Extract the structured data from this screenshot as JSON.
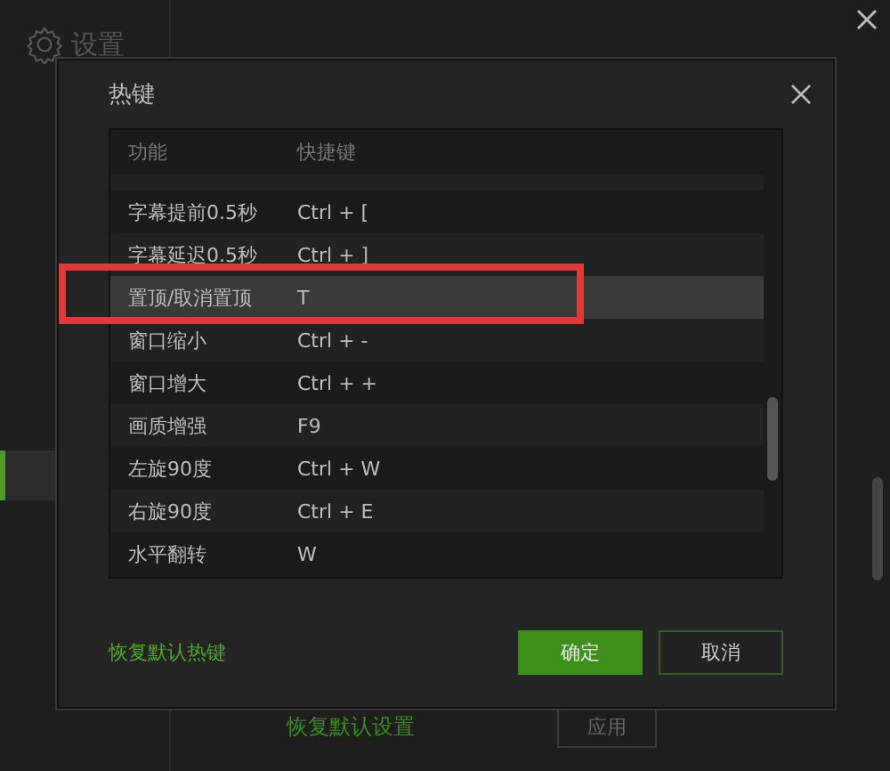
{
  "settings_window": {
    "title": "设置",
    "footer_link": "恢复默认设置",
    "footer_button": "应用"
  },
  "dialog": {
    "title": "热键",
    "table": {
      "columns": [
        "功能",
        "快捷键"
      ],
      "rows": [
        {
          "function": "字幕提前0.5秒",
          "shortcut": "Ctrl + [",
          "selected": false
        },
        {
          "function": "字幕延迟0.5秒",
          "shortcut": "Ctrl + ]",
          "selected": false
        },
        {
          "function": "置顶/取消置顶",
          "shortcut": "T",
          "selected": true
        },
        {
          "function": "窗口缩小",
          "shortcut": "Ctrl + -",
          "selected": false
        },
        {
          "function": "窗口增大",
          "shortcut": "Ctrl + +",
          "selected": false
        },
        {
          "function": "画质增强",
          "shortcut": "F9",
          "selected": false
        },
        {
          "function": "左旋90度",
          "shortcut": "Ctrl + W",
          "selected": false
        },
        {
          "function": "右旋90度",
          "shortcut": "Ctrl + E",
          "selected": false
        },
        {
          "function": "水平翻转",
          "shortcut": "W",
          "selected": false
        }
      ]
    },
    "restore_link": "恢复默认热键",
    "buttons": [
      {
        "label": "确定",
        "kind": "primary"
      },
      {
        "label": "取消",
        "kind": "secondary"
      }
    ]
  }
}
